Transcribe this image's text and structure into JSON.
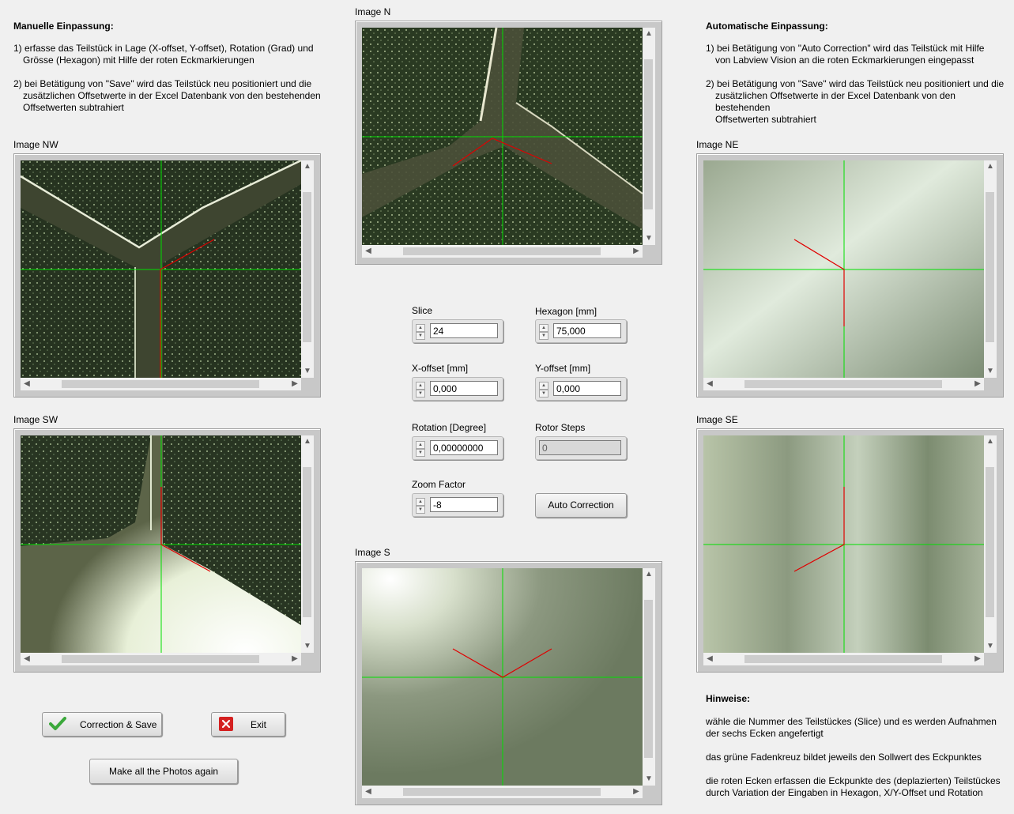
{
  "manual": {
    "title": "Manuelle Einpassung:",
    "step1_a": "1) erfasse das Teilstück in Lage (X-offset, Y-offset), Rotation (Grad) und",
    "step1_b": "Grösse (Hexagon) mit Hilfe der roten Eckmarkierungen",
    "step2_a": "2) bei Betätigung von \"Save\" wird das Teilstück neu positioniert und die",
    "step2_b": "zusätzlichen Offsetwerte in der Excel Datenbank von den bestehenden",
    "step2_c": "Offsetwerten subtrahiert"
  },
  "automatic": {
    "title": "Automatische Einpassung:",
    "step1_a": "1) bei Betätigung von \"Auto Correction\" wird das Teilstück mit Hilfe",
    "step1_b": "von Labview Vision an die roten Eckmarkierungen eingepasst",
    "step2_a": "2) bei Betätigung von \"Save\" wird das Teilstück neu positioniert und die",
    "step2_b": "zusätzlichen Offsetwerte in der Excel Datenbank von den bestehenden",
    "step2_c": "Offsetwerten subtrahiert"
  },
  "images": {
    "n": "Image N",
    "nw": "Image NW",
    "ne": "Image NE",
    "sw": "Image SW",
    "se": "Image SE",
    "s": "Image S"
  },
  "controls": {
    "slice_label": "Slice",
    "slice_value": "24",
    "hexagon_label": "Hexagon [mm]",
    "hexagon_value": "75,000",
    "xoffset_label": "X-offset [mm]",
    "xoffset_value": "0,000",
    "yoffset_label": "Y-offset [mm]",
    "yoffset_value": "0,000",
    "rotation_label": "Rotation [Degree]",
    "rotation_value": "0,00000000",
    "rotor_label": "Rotor Steps",
    "rotor_value": "0",
    "zoom_label": "Zoom Factor",
    "zoom_value": "-8",
    "auto_correction": "Auto Correction"
  },
  "buttons": {
    "correction_save": "Correction & Save",
    "exit": "Exit",
    "make_photos": "Make all the Photos again"
  },
  "hints": {
    "title": "Hinweise:",
    "h1_a": "wähle die Nummer des  Teilstückes (Slice) und es werden Aufnahmen",
    "h1_b": "der sechs Ecken angefertigt",
    "h2": "das grüne Fadenkreuz bildet jeweils den Sollwert des Eckpunktes",
    "h3_a": "die roten Ecken erfassen die Eckpunkte des (deplazierten) Teilstückes",
    "h3_b": "durch Variation der Eingaben in Hexagon, X/Y-Offset und Rotation"
  },
  "colors": {
    "crosshair": "#00e000",
    "corner_marker": "#e00000",
    "check_icon": "#3aa83a",
    "exit_icon": "#d42020"
  },
  "icons": {
    "correction_save": "check-icon",
    "exit": "close-icon"
  }
}
